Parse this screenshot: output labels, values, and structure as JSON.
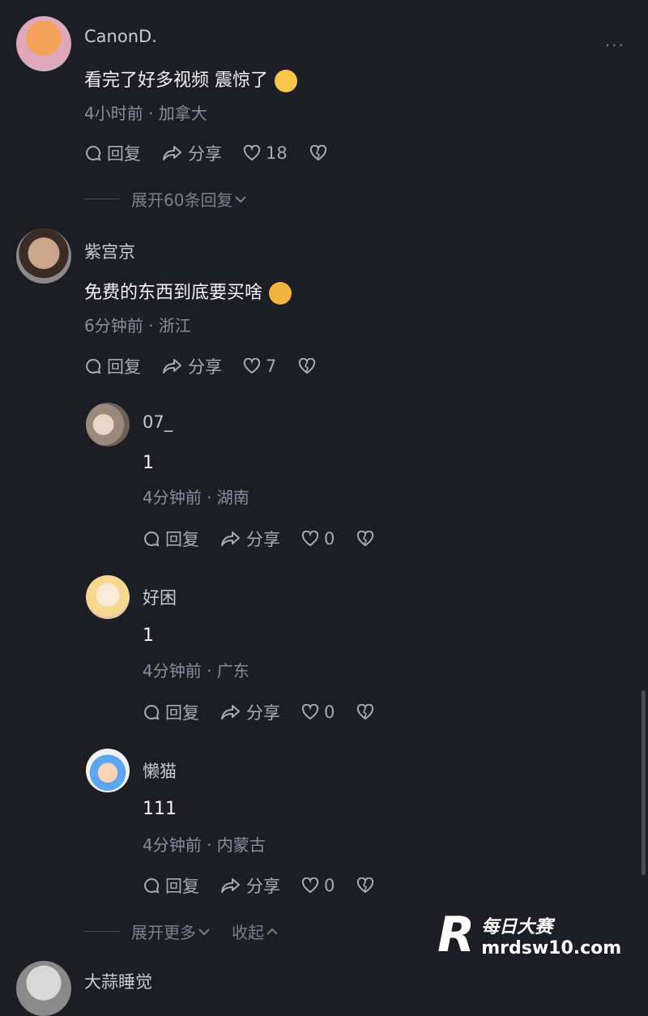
{
  "comments": [
    {
      "author": "CanonD.",
      "text": "看完了好多视频 震惊了",
      "meta": "4小时前 · 加拿大",
      "reply_label": "回复",
      "share_label": "分享",
      "likes": "18",
      "expand_label": "展开60条回复"
    },
    {
      "author": "紫宫京",
      "text": "免费的东西到底要买啥",
      "meta": "6分钟前 · 浙江",
      "reply_label": "回复",
      "share_label": "分享",
      "likes": "7"
    }
  ],
  "replies": [
    {
      "author": "07_",
      "text": "1",
      "meta": "4分钟前 · 湖南",
      "reply_label": "回复",
      "share_label": "分享",
      "likes": "0"
    },
    {
      "author": "好困",
      "text": "1",
      "meta": "4分钟前 · 广东",
      "reply_label": "回复",
      "share_label": "分享",
      "likes": "0"
    },
    {
      "author": "懒猫",
      "text": "111",
      "meta": "4分钟前 · 内蒙古",
      "reply_label": "回复",
      "share_label": "分享",
      "likes": "0"
    }
  ],
  "footer": {
    "expand_more": "展开更多",
    "collapse": "收起"
  },
  "watermark": {
    "title": "每日大赛",
    "url": "mrdsw10.com"
  },
  "partial_next_author": "大蒜睡觉"
}
